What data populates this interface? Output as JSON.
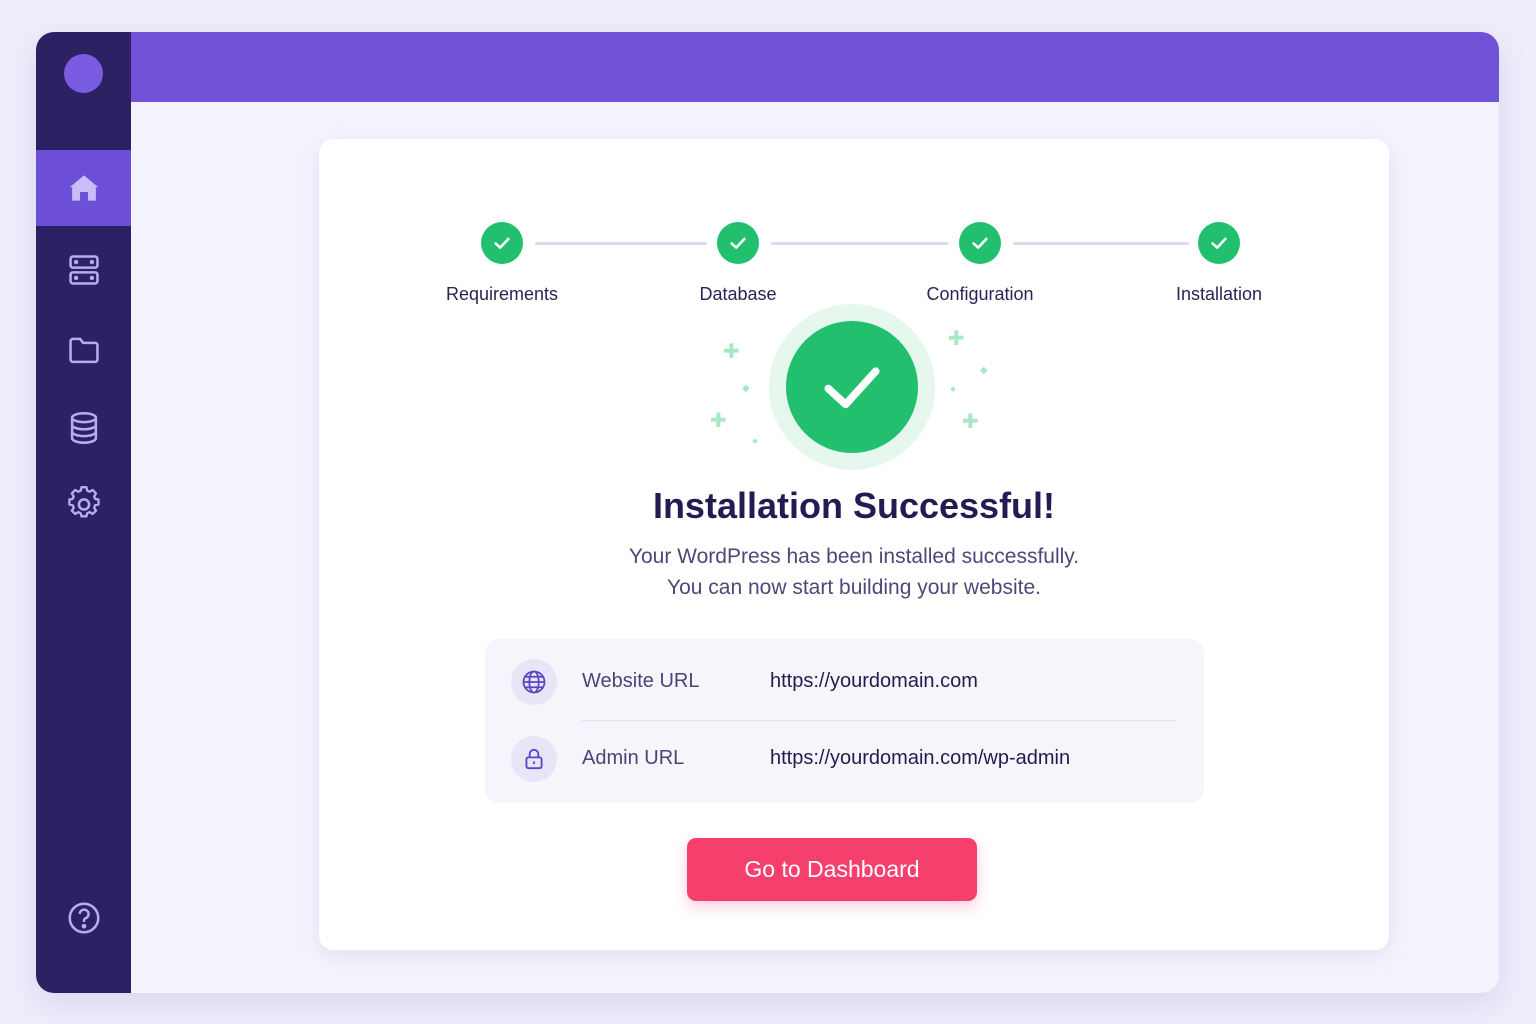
{
  "sidebar": {
    "items": [
      {
        "icon": "home-icon",
        "active": true
      },
      {
        "icon": "server-icon",
        "active": false
      },
      {
        "icon": "folder-icon",
        "active": false
      },
      {
        "icon": "database-icon",
        "active": false
      },
      {
        "icon": "gear-icon",
        "active": false
      }
    ],
    "help_icon": "help-icon"
  },
  "steps": [
    {
      "label": "Requirements",
      "status": "complete"
    },
    {
      "label": "Database",
      "status": "complete"
    },
    {
      "label": "Configuration",
      "status": "complete"
    },
    {
      "label": "Installation",
      "status": "complete"
    }
  ],
  "success": {
    "title": "Installation Successful!",
    "line1": "Your WordPress has been installed successfully.",
    "line2": "You can now start building your website."
  },
  "info": {
    "website": {
      "label": "Website URL",
      "value": "https://yourdomain.com",
      "icon": "globe-icon"
    },
    "admin": {
      "label": "Admin URL",
      "value": "https://yourdomain.com/wp-admin",
      "icon": "lock-icon"
    }
  },
  "cta": {
    "label": "Go to Dashboard"
  },
  "colors": {
    "sidebar": "#2c2263",
    "accent": "#6f52d6",
    "success": "#22c06e",
    "cta": "#f5406e"
  }
}
